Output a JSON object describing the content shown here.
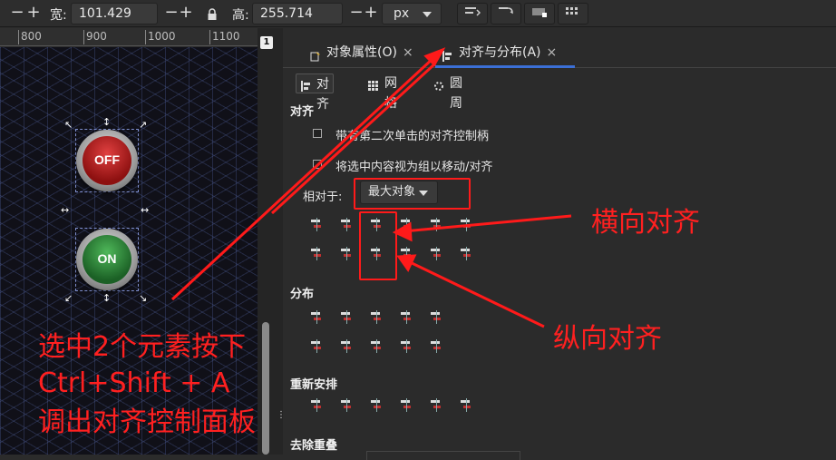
{
  "toolbar": {
    "minus": "−",
    "plus": "+",
    "width_label": "宽:",
    "width_value": "101.429",
    "lock_icon": "lock-icon",
    "height_label": "高:",
    "height_value": "255.714",
    "unit": "px"
  },
  "ruler": {
    "ticks": [
      "800",
      "900",
      "1000",
      "1100"
    ]
  },
  "canvas": {
    "off_label": "OFF",
    "on_label": "ON",
    "off_color": "#b21e1e",
    "on_color": "#2f8a3a"
  },
  "badge": "1",
  "tabs": [
    {
      "label": "对象属性(O)",
      "close": "×"
    },
    {
      "label": "对齐与分布(A)",
      "close": "×"
    }
  ],
  "subtabs": [
    "对齐",
    "网格",
    "圆周"
  ],
  "align": {
    "title": "对齐",
    "option1": "带有第二次单击的对齐控制柄",
    "option2": "将选中内容视为组以移动/对齐",
    "relative_label": "相对于:",
    "relative_value": "最大对象"
  },
  "distribute": {
    "title": "分布"
  },
  "rearrange": {
    "title": "重新安排"
  },
  "remove_overlap": {
    "title": "去除重叠"
  },
  "annotations": {
    "instruction_line1": "选中2个元素按下",
    "instruction_line2": "Ctrl+Shift + A",
    "instruction_line3": "调出对齐控制面板",
    "horizontal": "横向对齐",
    "vertical": "纵向对齐",
    "color": "#ff1a1a"
  }
}
